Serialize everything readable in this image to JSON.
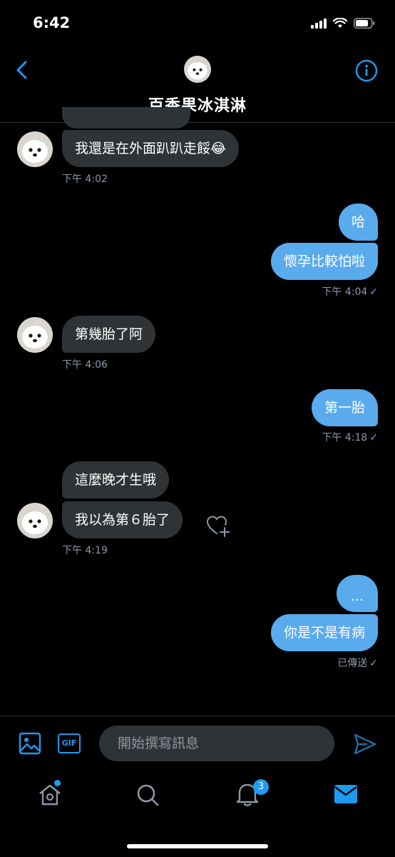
{
  "status_bar": {
    "time": "6:42"
  },
  "header": {
    "contact_name": "百香果冰淇淋"
  },
  "messages": [
    {
      "text": "我還是在外面趴趴走餒😂"
    },
    {
      "text": "哈"
    },
    {
      "text": "懷孕比較怕啦"
    },
    {
      "text": "第幾胎了阿"
    },
    {
      "text": "第一胎"
    },
    {
      "text": "這麼晚才生哦"
    },
    {
      "text": "我以為第６胎了"
    },
    {
      "text": "..."
    },
    {
      "text": "你是不是有病"
    }
  ],
  "timestamps": {
    "t1": "下午 4:02",
    "t2": "下午 4:04",
    "t3": "下午 4:06",
    "t4": "下午 4:18",
    "t5": "下午 4:19",
    "t6": "已傳送"
  },
  "composer": {
    "placeholder": "開始撰寫訊息",
    "gif_label": "GIF"
  },
  "tabbar": {
    "notifications_count": "3"
  },
  "colors": {
    "accent": "#1d9bf0",
    "outgoing_bubble": "#5aaaee",
    "incoming_bubble": "#2f3336",
    "background": "#000000"
  }
}
